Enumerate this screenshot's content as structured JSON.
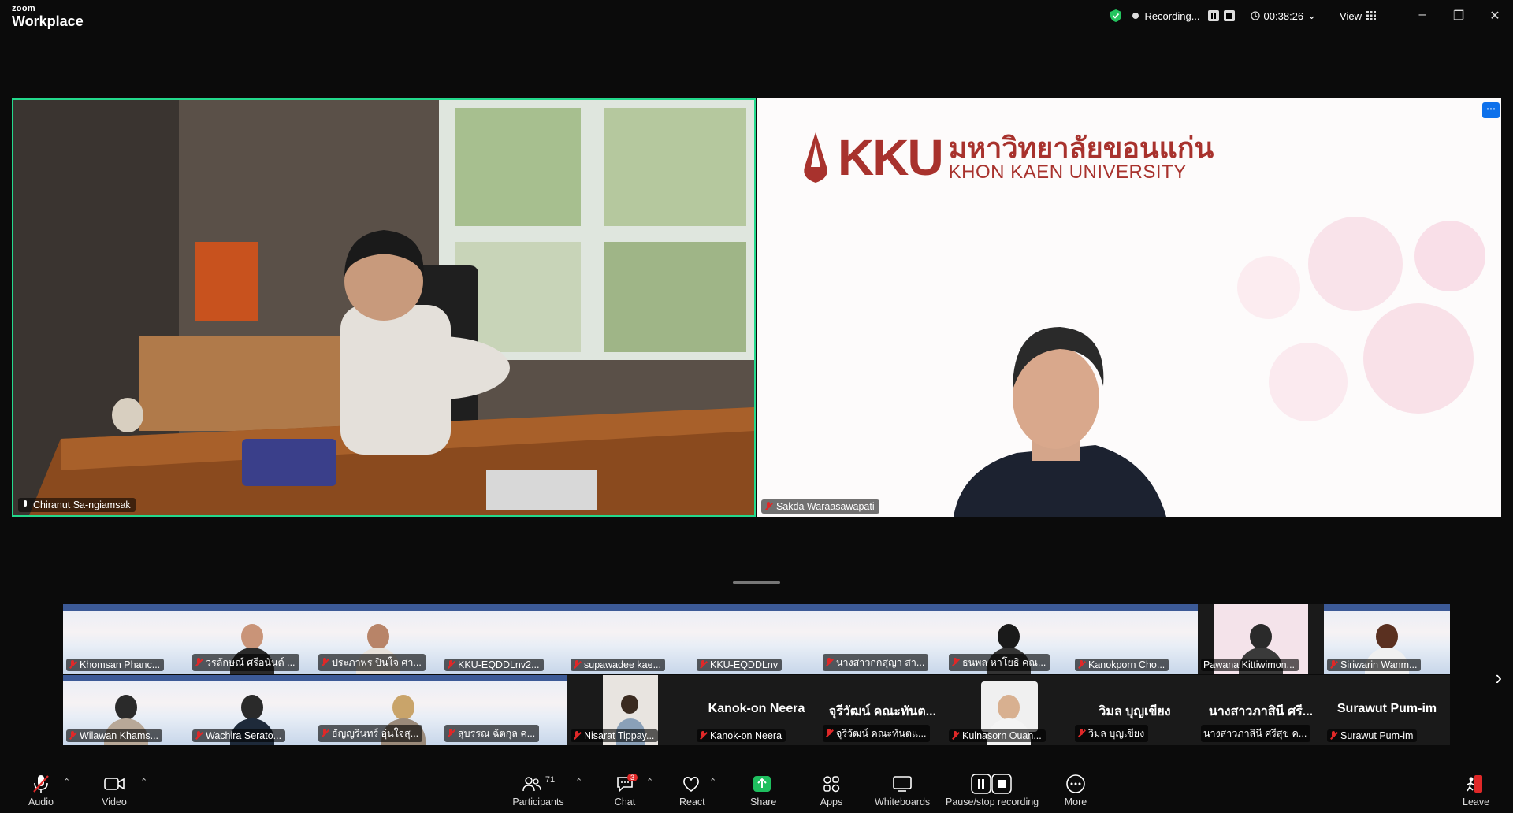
{
  "app": {
    "brand_small": "zoom",
    "brand_big": "Workplace"
  },
  "topbar": {
    "recording_label": "Recording...",
    "timer": "00:38:26",
    "view_label": "View"
  },
  "speakers": [
    {
      "name": "Chiranut Sa-ngiamsak"
    },
    {
      "name": "Sakda Waraasawapati"
    }
  ],
  "kku_slide": {
    "mark": "KKU",
    "thai": "มหาวิทยาลัยขอนแก่น",
    "english": "KHON KAEN UNIVERSITY"
  },
  "gallery_row1": [
    {
      "name": "Khomsan Phanc..."
    },
    {
      "name": "วรลักษณ์ ศรีอนันต์ ..."
    },
    {
      "name": "ประภาพร ปินใจ ศา..."
    },
    {
      "name": "KKU-EQDDLnv2..."
    },
    {
      "name": "supawadee kae..."
    },
    {
      "name": "KKU-EQDDLnv"
    },
    {
      "name": "นางสาวกกสุญา สา..."
    },
    {
      "name": "ธนพล หาโยธิ คณ..."
    },
    {
      "name": "Kanokporn Cho..."
    },
    {
      "name": "Pawana Kittiwimon..."
    },
    {
      "name": "Siriwarin Wanm..."
    }
  ],
  "gallery_row2": [
    {
      "name": "Wilawan Khams..."
    },
    {
      "name": "Wachira Serato..."
    },
    {
      "name": "ธัญญรินทร์ อุ่นใจสุ..."
    },
    {
      "name": "สุบรรณ ฉัตกุล ค..."
    },
    {
      "name": "Nisarat Tippay..."
    },
    {
      "name": "Kanok-on Neera",
      "big": "Kanok-on Neera"
    },
    {
      "name": "จุรีวัฒน์ คณะทันตแ...",
      "big": "จุรีวัฒน์ คณะทันต..."
    },
    {
      "name": "Kulnasorn Ouan..."
    },
    {
      "name": "วิมล บุญเขียง",
      "big": "วิมล บุญเขียง"
    },
    {
      "name": "นางสาวภาสินี ศรีสุข ค...",
      "big": "นางสาวภาสินี ศรี..."
    },
    {
      "name": "Surawut Pum-im",
      "big": "Surawut Pum-im"
    }
  ],
  "toolbar": {
    "audio": "Audio",
    "video": "Video",
    "participants": "Participants",
    "participants_count": "71",
    "chat": "Chat",
    "chat_badge": "3",
    "react": "React",
    "share": "Share",
    "apps": "Apps",
    "whiteboards": "Whiteboards",
    "recording": "Pause/stop recording",
    "more": "More",
    "leave": "Leave"
  },
  "colors": {
    "active_speaker": "#23d98c",
    "share_green": "#1fbf5f",
    "leave_red": "#e02828",
    "kku_red": "#a8322d"
  }
}
